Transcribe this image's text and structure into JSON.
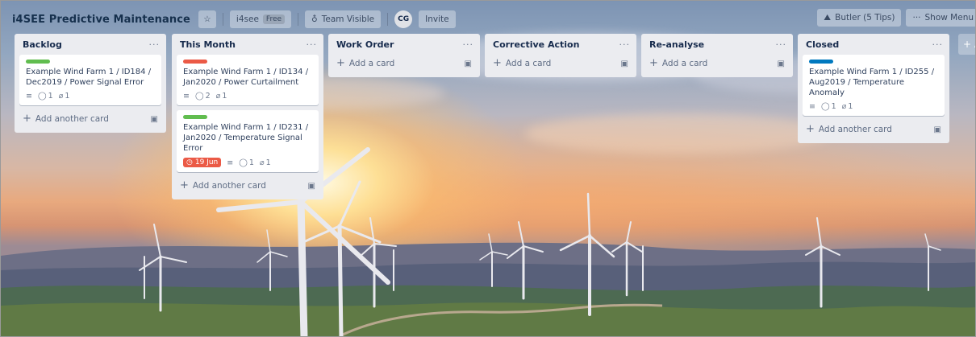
{
  "board": {
    "title": "i4SEE Predictive Maintenance",
    "workspace": "i4see",
    "workspace_badge": "Free",
    "visibility": "Team Visible",
    "avatar_initials": "CG",
    "invite": "Invite",
    "butler": "Butler (5 Tips)",
    "show_menu": "Show Menu",
    "add_list_glyph": "+ A"
  },
  "lists": [
    {
      "title": "Backlog",
      "menu": "···",
      "add_label": "Add another card",
      "cards": [
        {
          "label_color": "#61bd4f",
          "title": "Example Wind Farm 1 / ID184 / Dec2019 / Power Signal Error",
          "comments": "1",
          "attachments": "1"
        }
      ]
    },
    {
      "title": "This Month",
      "menu": "···",
      "add_label": "Add another card",
      "cards": [
        {
          "label_color": "#eb5a46",
          "title": "Example Wind Farm 1 / ID134 / Jan2020 / Power Curtailment",
          "comments": "2",
          "attachments": "1"
        },
        {
          "label_color": "#61bd4f",
          "title": "Example Wind Farm 1 / ID231 / Jan2020 / Temperature Signal Error",
          "due": "19 Jun",
          "comments": "1",
          "attachments": "1"
        }
      ]
    },
    {
      "title": "Work Order",
      "menu": "···",
      "add_label": "Add a card",
      "cards": []
    },
    {
      "title": "Corrective Action",
      "menu": "···",
      "add_label": "Add a card",
      "cards": []
    },
    {
      "title": "Re-analyse",
      "menu": "···",
      "add_label": "Add a card",
      "cards": []
    },
    {
      "title": "Closed",
      "menu": "···",
      "add_label": "Add another card",
      "cards": [
        {
          "label_color": "#0079bf",
          "title": "Example Wind Farm 1 / ID255 / Aug2019 / Temperature Anomaly",
          "comments": "1",
          "attachments": "1"
        }
      ]
    }
  ],
  "icons": {
    "star": "star-icon",
    "team": "team-icon",
    "butler": "butler-icon",
    "description": "description-icon",
    "comment": "comment-icon",
    "attachment": "attachment-icon",
    "clock": "clock-icon",
    "template": "card-template-icon"
  }
}
